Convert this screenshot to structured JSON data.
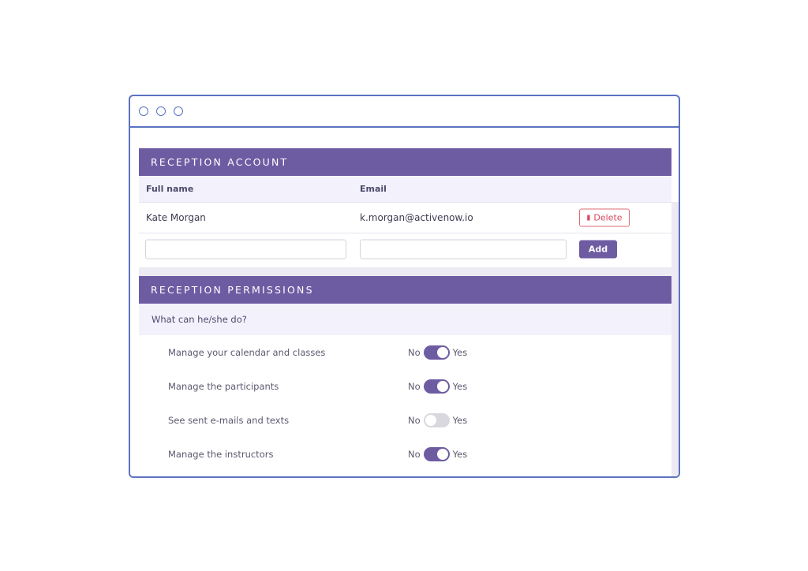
{
  "account": {
    "header": "RECEPTION ACCOUNT",
    "columns": {
      "full_name": "Full name",
      "email": "Email"
    },
    "rows": [
      {
        "name": "Kate Morgan",
        "email": "k.morgan@activenow.io",
        "action": "Delete"
      }
    ],
    "new_entry": {
      "name_value": "",
      "email_value": "",
      "add_label": "Add"
    }
  },
  "permissions": {
    "header": "RECEPTION PERMISSIONS",
    "question": "What can he/she do?",
    "no_label": "No",
    "yes_label": "Yes",
    "items": [
      {
        "label": "Manage your calendar and classes",
        "enabled": true
      },
      {
        "label": "Manage the participants",
        "enabled": true
      },
      {
        "label": "See sent e-mails and texts",
        "enabled": false
      },
      {
        "label": "Manage the instructors",
        "enabled": true
      }
    ]
  },
  "colors": {
    "accent": "#6e5ca3",
    "window_border": "#5b73c0",
    "danger": "#d9485a"
  }
}
